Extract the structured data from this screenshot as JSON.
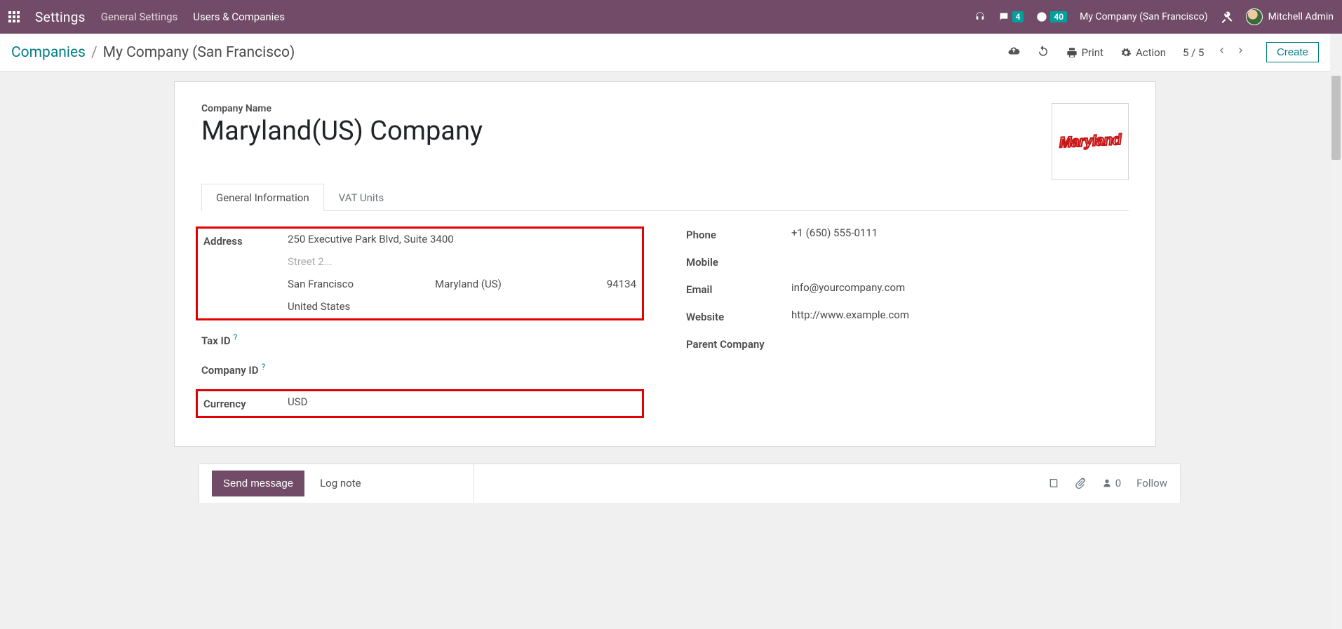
{
  "navbar": {
    "brand": "Settings",
    "menu": [
      "General Settings",
      "Users & Companies"
    ],
    "messaging_badge": "4",
    "activities_badge": "40",
    "company": "My Company (San Francisco)",
    "user": "Mitchell Admin"
  },
  "control_panel": {
    "breadcrumb_root": "Companies",
    "breadcrumb_current": "My Company (San Francisco)",
    "print_label": "Print",
    "action_label": "Action",
    "pager": "5 / 5",
    "create_label": "Create"
  },
  "form": {
    "title_label": "Company Name",
    "title_value": "Maryland(US) Company",
    "logo_text": "Maryland",
    "tabs": [
      "General Information",
      "VAT Units"
    ],
    "left": {
      "address_label": "Address",
      "street": "250 Executive Park Blvd, Suite 3400",
      "street2_placeholder": "Street 2...",
      "city": "San Francisco",
      "state": "Maryland (US)",
      "zip": "94134",
      "country": "United States",
      "tax_id_label": "Tax ID",
      "company_id_label": "Company ID",
      "currency_label": "Currency",
      "currency_value": "USD"
    },
    "right": {
      "phone_label": "Phone",
      "phone_value": "+1 (650) 555-0111",
      "mobile_label": "Mobile",
      "email_label": "Email",
      "email_value": "info@yourcompany.com",
      "website_label": "Website",
      "website_value": "http://www.example.com",
      "parent_label": "Parent Company"
    }
  },
  "chatter": {
    "send": "Send message",
    "log": "Log note",
    "followers": "0",
    "follow": "Follow"
  }
}
